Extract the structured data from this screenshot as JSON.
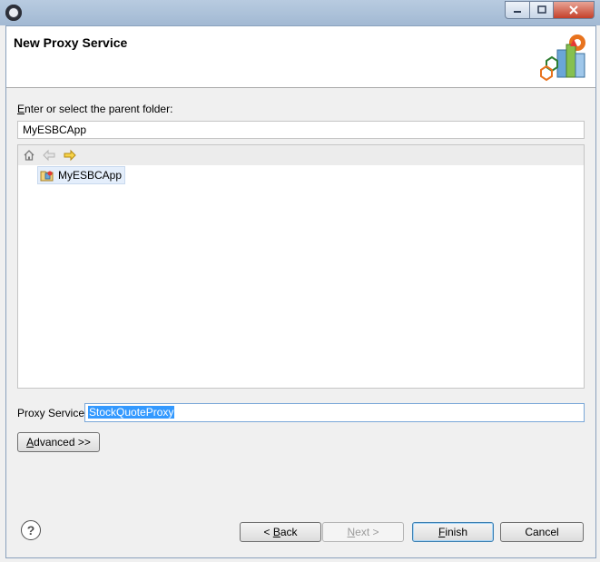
{
  "window": {
    "title_bar_buttons": [
      "minimize",
      "maximize",
      "close"
    ]
  },
  "header": {
    "title": "New Proxy Service"
  },
  "parent_folder": {
    "label": "Enter or select the parent folder:",
    "label_mnemonic": "E",
    "label_rest": "nter or select the parent folder:",
    "value": "MyESBCApp"
  },
  "tree": {
    "toolbar_icons": [
      "home-icon",
      "back-arrow-icon",
      "forward-arrow-icon"
    ],
    "items": [
      {
        "label": "MyESBCApp",
        "icon": "project-icon",
        "selected": true
      }
    ]
  },
  "proxy_service": {
    "label": "Proxy Service",
    "value": "StockQuoteProxy"
  },
  "advanced_button": {
    "mnemonic": "A",
    "rest": "dvanced >>"
  },
  "footer": {
    "back_prefix": "< ",
    "back_mnemonic": "B",
    "back_rest": "ack",
    "next_mnemonic": "N",
    "next_rest": "ext >",
    "finish_mnemonic": "F",
    "finish_rest": "inish",
    "cancel_label": "Cancel",
    "help_glyph": "?"
  },
  "colors": {
    "selection": "#3399ff",
    "header_bg": "#ffffff",
    "dialog_bg": "#f0f0f0"
  }
}
